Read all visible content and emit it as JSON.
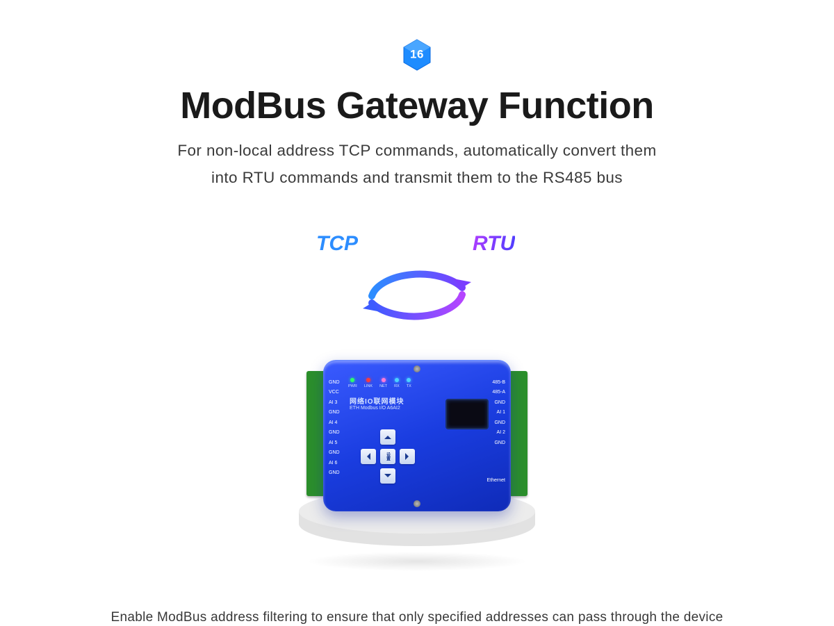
{
  "badge": {
    "text": "16",
    "fill": "#1e8cff"
  },
  "title": "ModBus Gateway Function",
  "subtitle_line1": "For non-local address TCP commands, automatically convert them",
  "subtitle_line2": "into RTU commands and transmit them to the RS485 bus",
  "conversion": {
    "left_label": "TCP",
    "right_label": "RTU"
  },
  "device": {
    "leds": [
      {
        "name": "PWR",
        "color": "green"
      },
      {
        "name": "LINK",
        "color": "red"
      },
      {
        "name": "NET",
        "color": "pink"
      },
      {
        "name": "RX",
        "color": "blue"
      },
      {
        "name": "TX",
        "color": "blue"
      }
    ],
    "left_ports": [
      "GND",
      "VCC",
      "AI 3",
      "GND",
      "AI 4",
      "GND",
      "AI 5",
      "GND",
      "AI 6",
      "GND"
    ],
    "right_ports": [
      "485-B",
      "485-A",
      "GND",
      "AI 1",
      "GND",
      "AI 2",
      "GND"
    ],
    "right_extra": "Ethernet",
    "brand_line1": "网络IO联网模块",
    "brand_line2": "ETH Modbus I/O A6AI2",
    "center_button": "设置"
  },
  "footer": "Enable ModBus address filtering to ensure that only specified addresses can pass through the device"
}
